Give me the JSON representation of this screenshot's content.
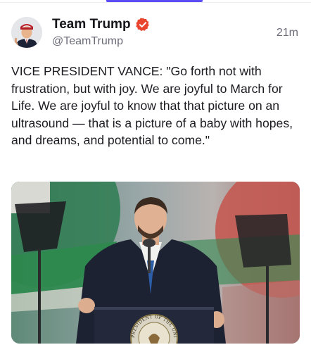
{
  "post": {
    "author_name": "Team Trump",
    "handle": "@TeamTrump",
    "timestamp": "21m",
    "body": "VICE PRESIDENT VANCE: \"Go forth not with frustration, but with joy. We are joyful to March for Life. We are joyful to know that that picture on an ultrasound — that is a picture of a baby with hopes, and dreams, and potential to come.\""
  },
  "media": {
    "seal_text": "PRESIDENT OF THE UNITED"
  },
  "colors": {
    "accent": "#5b4cf5",
    "verified_badge": "#e8442e",
    "secondary_text": "#6b6b78"
  },
  "icons": {
    "verified": "verified-badge-icon",
    "avatar": "avatar-image"
  }
}
